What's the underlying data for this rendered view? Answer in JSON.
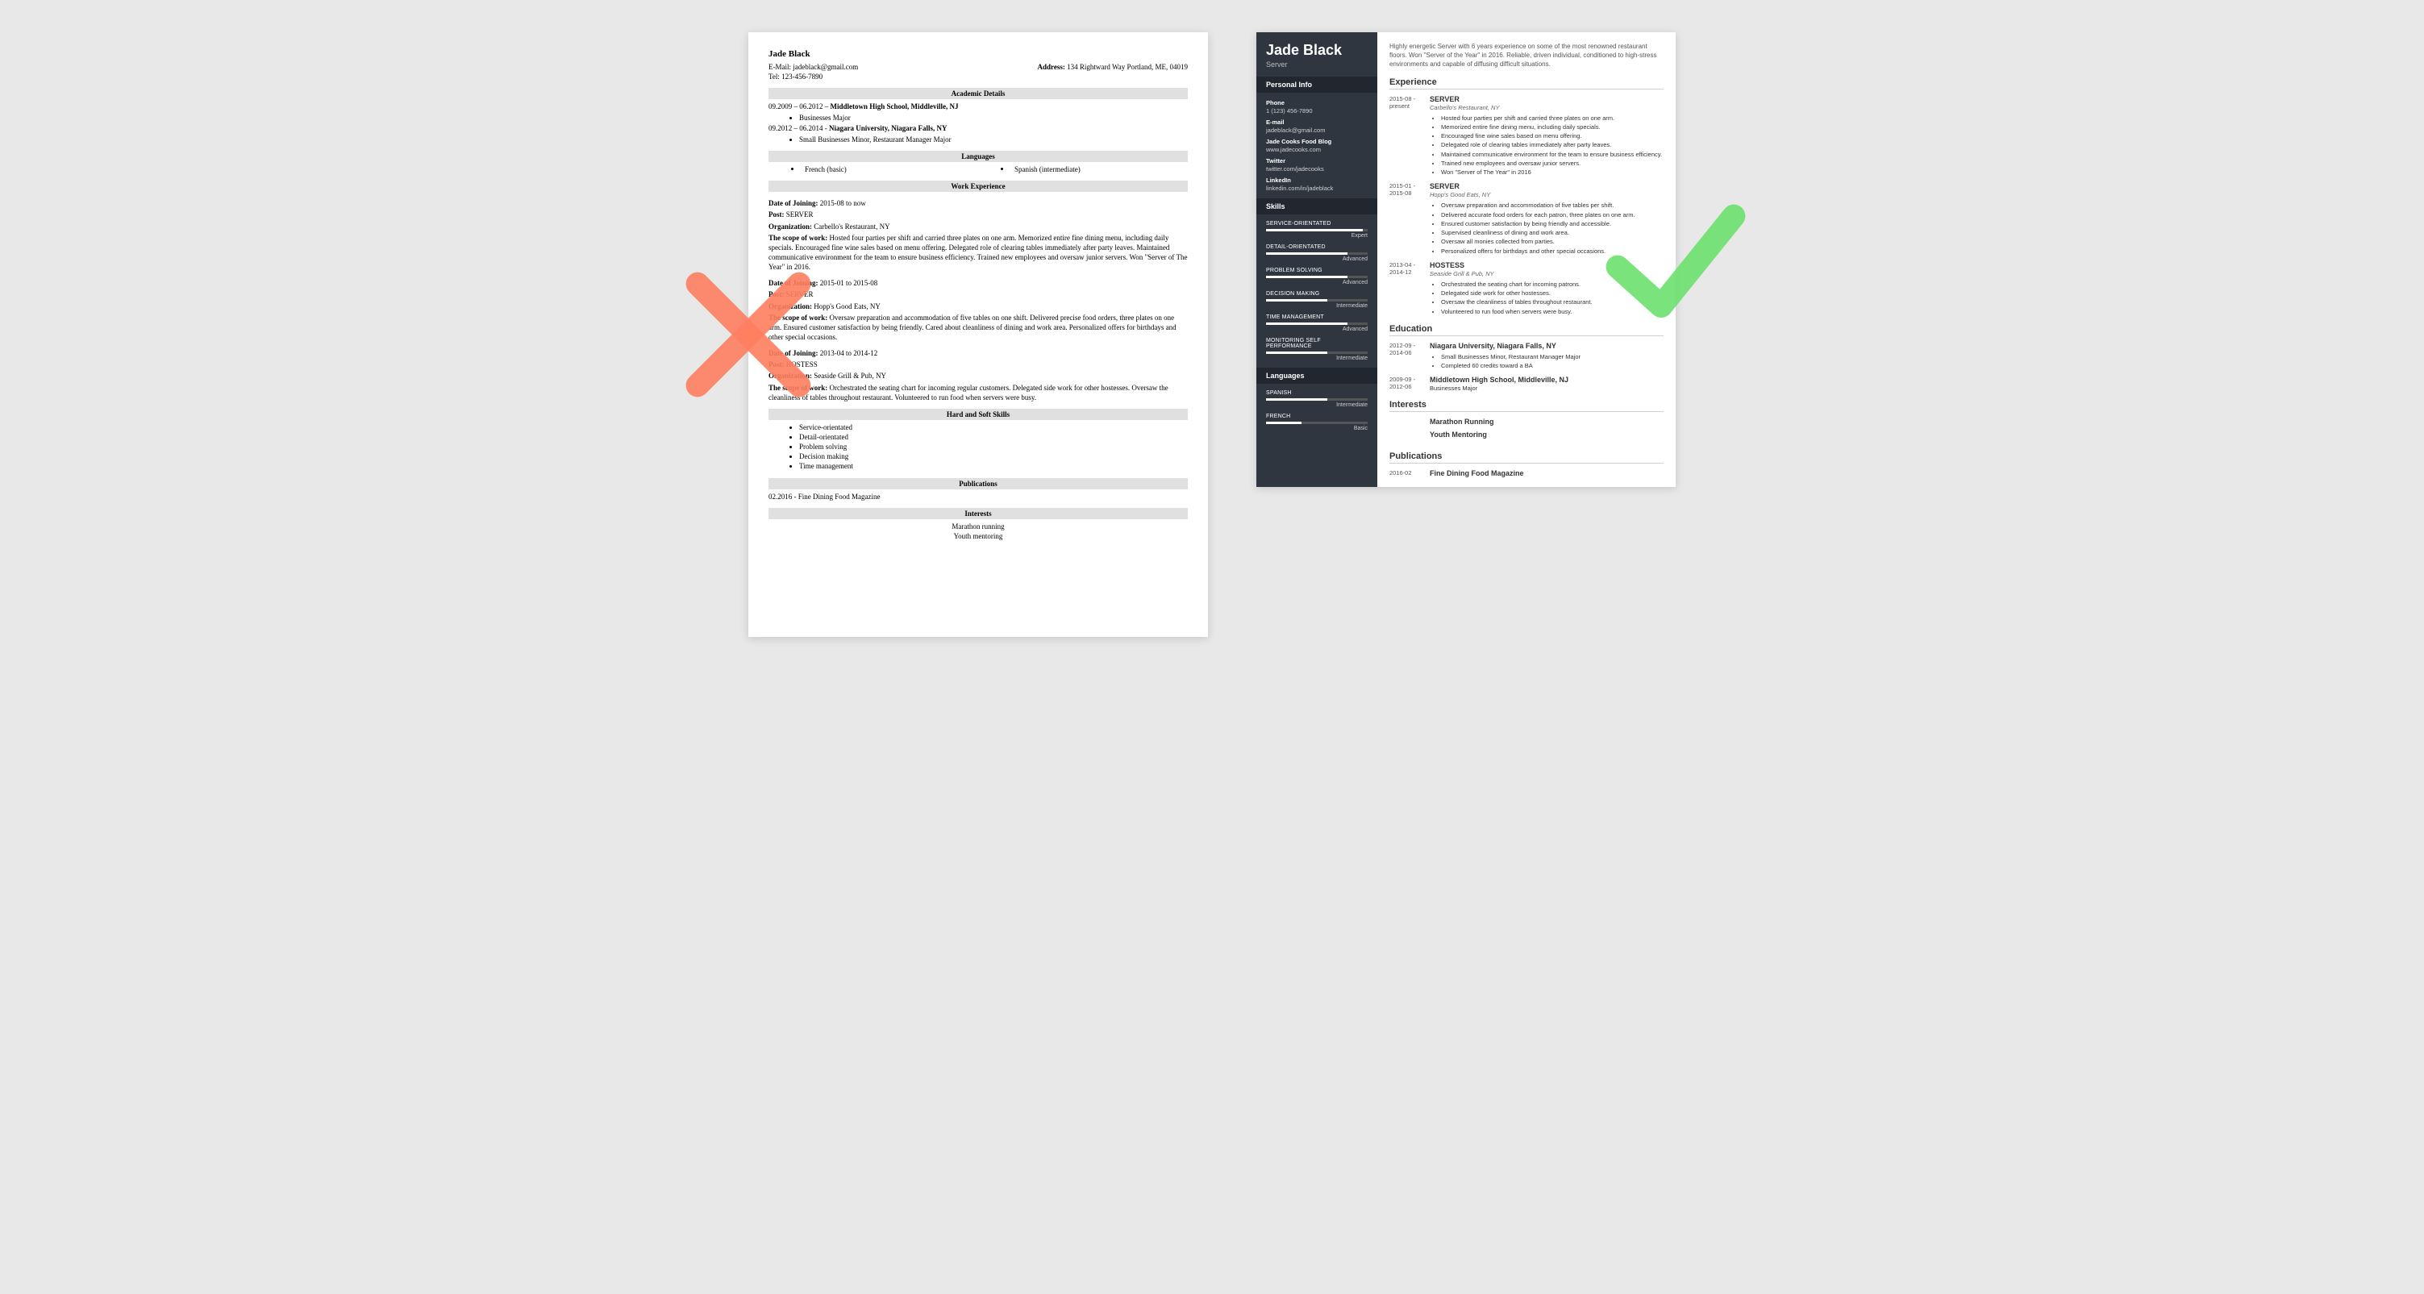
{
  "left": {
    "name": "Jade Black",
    "email_label": "E-Mail:",
    "email": "jadeblack@gmail.com",
    "address_label": "Address:",
    "address": "134 Rightward Way Portland, ME, 04019",
    "tel_label": "Tel:",
    "tel": "123-456-7890",
    "sections": {
      "academic": "Academic Details",
      "languages": "Languages",
      "work": "Work Experience",
      "skills": "Hard and Soft Skills",
      "pubs": "Publications",
      "interests": "Interests"
    },
    "academic": [
      {
        "dates": "09.2009 – 06.2012 – ",
        "school": "Middletown High School, Middleville, NJ",
        "bullets": [
          "Businesses Major"
        ]
      },
      {
        "dates": "09.2012 – 06.2014 - ",
        "school": "Niagara University, Niagara Falls, NY",
        "bullets": [
          "Small Businesses Minor, Restaurant Manager Major"
        ]
      }
    ],
    "languages": [
      "French (basic)",
      "Spanish (intermediate)"
    ],
    "labels": {
      "doj": "Date of Joining:",
      "post": "Post:",
      "org": "Organization:",
      "scope": "The scope of work:"
    },
    "jobs": [
      {
        "doj": "2015-08 to now",
        "post": "SERVER",
        "org": "Carbello's Restaurant, NY",
        "scope": "Hosted four parties per shift and carried three plates on one arm. Memorized entire fine dining menu, including daily specials. Encouraged fine wine sales based on menu offering. Delegated role of clearing tables immediately after party leaves. Maintained communicative environment for the team to ensure business efficiency. Trained new employees and oversaw junior servers. Won \"Server of The Year\" in 2016."
      },
      {
        "doj": "2015-01 to 2015-08",
        "post": "SERVER",
        "org": "Hopp's Good Eats, NY",
        "scope": "Oversaw preparation and accommodation of five tables on one shift. Delivered precise food orders, three plates on one arm. Ensured customer satisfaction by being friendly. Cared about cleanliness of dining and work area. Personalized offers for birthdays and other special occasions."
      },
      {
        "doj": "2013-04 to 2014-12",
        "post": "HOSTESS",
        "org": "Seaside Grill & Pub, NY",
        "scope": "Orchestrated the seating chart for incoming regular customers. Delegated side work for other hostesses. Oversaw the cleanliness of tables throughout restaurant. Volunteered to run food when servers were busy."
      }
    ],
    "skills": [
      "Service-orientated",
      "Detail-orientated",
      "Problem solving",
      "Decision making",
      "Time management"
    ],
    "pubs": "02.2016  - Fine Dining Food Magazine",
    "interests": [
      "Marathon running",
      "Youth mentoring"
    ]
  },
  "right": {
    "name": "Jade Black",
    "role": "Server",
    "sidebar_sections": {
      "pi": "Personal Info",
      "skills": "Skills",
      "langs": "Languages"
    },
    "info": [
      {
        "lbl": "Phone",
        "val": "1 (123) 456-7890"
      },
      {
        "lbl": "E-mail",
        "val": "jadeblack@gmail.com"
      },
      {
        "lbl": "Jade Cooks Food Blog",
        "val": "www.jadecooks.com"
      },
      {
        "lbl": "Twitter",
        "val": "twitter.com/jadecooks"
      },
      {
        "lbl": "LinkedIn",
        "val": "linkedin.com/in/jadeblack"
      }
    ],
    "skills": [
      {
        "name": "SERVICE-ORIENTATED",
        "level": "Expert",
        "pct": 95
      },
      {
        "name": "DETAIL-ORIENTATED",
        "level": "Advanced",
        "pct": 80
      },
      {
        "name": "PROBLEM SOLVING",
        "level": "Advanced",
        "pct": 80
      },
      {
        "name": "DECISION MAKING",
        "level": "Intermediate",
        "pct": 60
      },
      {
        "name": "TIME MANAGEMENT",
        "level": "Advanced",
        "pct": 80
      },
      {
        "name": "MONITORING SELF PERFORMANCE",
        "level": "Intermediate",
        "pct": 60
      }
    ],
    "langs": [
      {
        "name": "SPANISH",
        "level": "Intermediate",
        "pct": 60
      },
      {
        "name": "FRENCH",
        "level": "Basic",
        "pct": 35
      }
    ],
    "summary": "Highly energetic Server with 6 years experience on some of the most renowned restaurant floors. Won \"Server of the Year\" in 2016. Reliable, driven individual, conditioned to high-stress environments and capable of diffusing difficult situations.",
    "headers": {
      "exp": "Experience",
      "edu": "Education",
      "int": "Interests",
      "pub": "Publications"
    },
    "exp": [
      {
        "dates": "2015-08 - present",
        "title": "SERVER",
        "org": "Carbello's Restaurant, NY",
        "bullets": [
          "Hosted four parties per shift and carried three plates on one arm.",
          "Memorized entire fine dining menu, including daily specials.",
          "Encouraged fine wine sales based on menu offering.",
          "Delegated role of clearing tables immediately after party leaves.",
          "Maintained communicative environment for the team to ensure business efficiency.",
          "Trained new employees and oversaw junior servers.",
          "Won \"Server of The Year\" in 2016"
        ]
      },
      {
        "dates": "2015-01 - 2015-08",
        "title": "SERVER",
        "org": "Hopp's Good Eats, NY",
        "bullets": [
          "Oversaw preparation and accommodation of five tables per shift.",
          "Delivered accurate food orders for each patron, three plates on one arm.",
          "Ensured customer satisfaction by being friendly and accessible.",
          "Supervised cleanliness of dining and work area.",
          "Oversaw all monies collected from parties.",
          "Personalized offers for birthdays and other special occasions."
        ]
      },
      {
        "dates": "2013-04 - 2014-12",
        "title": "HOSTESS",
        "org": "Seaside Grill & Pub, NY",
        "bullets": [
          "Orchestrated the seating chart for incoming patrons.",
          "Delegated side work for other hostesses.",
          "Oversaw the cleanliness of tables throughout restaurant.",
          "Volunteered to run food when servers were busy."
        ]
      }
    ],
    "edu": [
      {
        "dates": "2012-09 - 2014-06",
        "title": "Niagara University, Niagara Falls, NY",
        "bullets": [
          "Small Businesses Minor, Restaurant Manager Major",
          "Completed 60 credits toward a BA"
        ]
      },
      {
        "dates": "2009-09 - 2012-06",
        "title": "Middletown High School, Middleville, NJ",
        "plain": "Businesses Major"
      }
    ],
    "interests": [
      "Marathon Running",
      "Youth Mentoring"
    ],
    "pubs": [
      {
        "dates": "2016-02",
        "title": "Fine Dining Food Magazine"
      }
    ]
  }
}
